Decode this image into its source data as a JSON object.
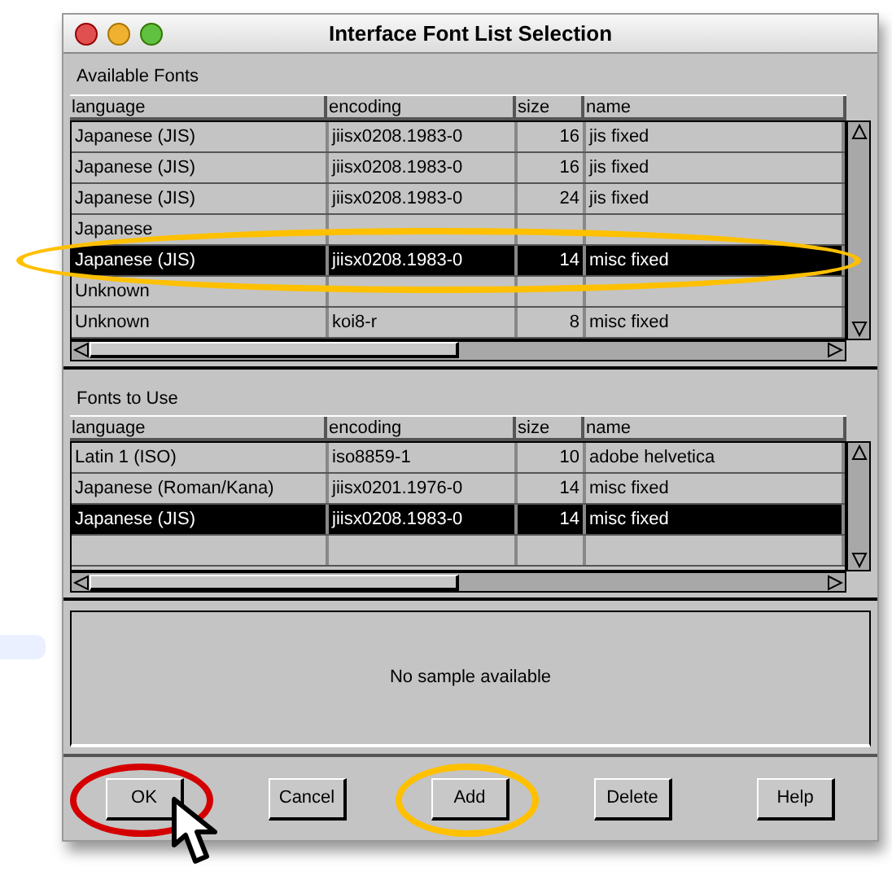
{
  "window": {
    "title": "Interface Font List Selection"
  },
  "available_fonts": {
    "label": "Available Fonts",
    "columns": [
      "language",
      "encoding",
      "size",
      "name"
    ],
    "rows": [
      {
        "cells": {
          "language": "Japanese (JIS)",
          "encoding": "jiisx0208.1983-0",
          "size": "16",
          "name": "jis fixed"
        },
        "selected": false,
        "circled": false
      },
      {
        "cells": {
          "language": "Japanese (JIS)",
          "encoding": "jiisx0208.1983-0",
          "size": "16",
          "name": "jis fixed"
        },
        "selected": false,
        "circled": false
      },
      {
        "cells": {
          "language": "Japanese (JIS)",
          "encoding": "jiisx0208.1983-0",
          "size": "24",
          "name": "jis fixed"
        },
        "selected": false,
        "circled": false
      },
      {
        "cells": {
          "language": "Japanese"
        },
        "selected": false,
        "circled": false
      },
      {
        "cells": {
          "language": "Japanese (JIS)",
          "encoding": "jiisx0208.1983-0",
          "size": "14",
          "name": "misc fixed"
        },
        "selected": true,
        "circled": true,
        "color": "#ffc000"
      },
      {
        "cells": {
          "language": "Unknown"
        },
        "selected": false,
        "circled": false
      },
      {
        "cells": {
          "language": "Unknown",
          "encoding": "koi8-r",
          "size": "8",
          "name": "misc fixed"
        },
        "selected": false,
        "circled": false
      }
    ]
  },
  "fonts_to_use": {
    "label": "Fonts to Use",
    "columns": [
      "language",
      "encoding",
      "size",
      "name"
    ],
    "rows": [
      {
        "cells": {
          "language": "Latin 1 (ISO)",
          "encoding": "iso8859-1",
          "size": "10",
          "name": "adobe helvetica"
        },
        "selected": false,
        "circled": false
      },
      {
        "cells": {
          "language": "Japanese (Roman/Kana)",
          "encoding": "jiisx0201.1976-0",
          "size": "14",
          "name": "misc fixed"
        },
        "selected": false,
        "circled": false
      },
      {
        "cells": {
          "language": "Japanese (JIS)",
          "encoding": "jiisx0208.1983-0",
          "size": "14",
          "name": "misc fixed"
        },
        "selected": true,
        "circled": false
      }
    ]
  },
  "sample": {
    "text": "No sample available"
  },
  "buttons": [
    {
      "label": "OK",
      "circled": true,
      "color": "#d40000",
      "pointer": true
    },
    {
      "label": "Cancel",
      "circled": false,
      "pointer": false
    },
    {
      "label": "Add",
      "circled": true,
      "color": "#ffc000",
      "pointer": false
    },
    {
      "label": "Delete",
      "circled": false,
      "pointer": false
    },
    {
      "label": "Help",
      "circled": false,
      "pointer": false
    }
  ]
}
